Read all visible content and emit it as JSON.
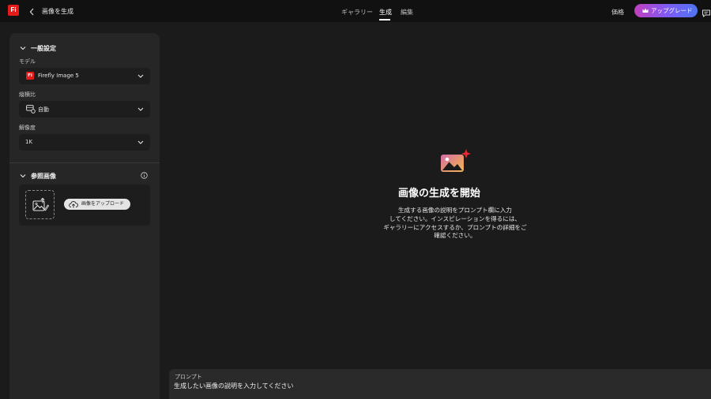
{
  "app": {
    "logo_text": "Fi",
    "brand_color": "#e41b1b"
  },
  "header": {
    "title": "画像を生成",
    "tabs": [
      {
        "label": "ギャラリー",
        "active": false
      },
      {
        "label": "生成",
        "active": true
      },
      {
        "label": "編集",
        "active": false
      }
    ],
    "price_label": "価格",
    "upgrade_label": "アップグレード",
    "icons": {
      "back": "chevron-left-icon",
      "upgrade": "crown-icon",
      "feedback": "chat-icon"
    }
  },
  "sidebar": {
    "general_settings": {
      "heading": "一般設定",
      "model": {
        "label": "モデル",
        "value": "Firefly Image 5",
        "icon_text": "Fi"
      },
      "aspect_ratio": {
        "label": "縦横比",
        "value": "自動",
        "icon": "aspect-ratio-icon"
      },
      "resolution": {
        "label": "解像度",
        "value": "1K"
      }
    },
    "reference_image": {
      "heading": "参照画像",
      "upload_label": "画像をアップロード",
      "icons": {
        "info": "info-icon",
        "placeholder": "image-placeholder-icon",
        "upload": "cloud-upload-icon"
      }
    }
  },
  "main": {
    "title": "画像の生成を開始",
    "description_lines": [
      "生成する画像の説明をプロンプト欄に入力",
      "してください。インスピレーションを得るには、",
      "ギャラリーにアクセスするか、プロンプトの詳細をご",
      "確認ください。"
    ],
    "icon": "image-sparkle-icon"
  },
  "prompt": {
    "label": "プロンプト",
    "placeholder": "生成したい画像の説明を入力してください"
  },
  "colors": {
    "background": "#1b1b1b",
    "topbar": "#111111",
    "panel": "#262626",
    "field": "#1d1d1d",
    "upgrade_gradient": [
      "#c13fbf",
      "#7b5cf5",
      "#4d74f0"
    ]
  }
}
